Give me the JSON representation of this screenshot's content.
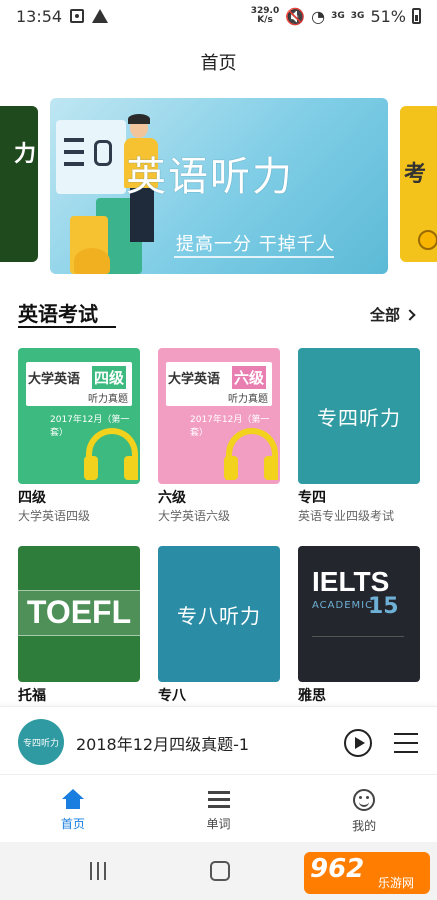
{
  "status_bar": {
    "time": "13:54",
    "speed_value": "329.0",
    "speed_unit": "K/s",
    "network_1": "3G",
    "network_2": "3G",
    "battery": "51%"
  },
  "header": {
    "title": "首页"
  },
  "banner": {
    "title": "英语听力",
    "subtitle": "提高一分 干掉千人",
    "prev_fragment": "力",
    "next_fragment": "考"
  },
  "section": {
    "title": "英语考试",
    "more_label": "全部"
  },
  "cards": [
    {
      "name": "四级",
      "desc": "大学英语四级",
      "thumb_main": "大学英语",
      "thumb_level": "四级",
      "thumb_sub": "听力真题",
      "thumb_date": "2017年12月（第一套）"
    },
    {
      "name": "六级",
      "desc": "大学英语六级",
      "thumb_main": "大学英语",
      "thumb_level": "六级",
      "thumb_sub": "听力真题",
      "thumb_date": "2017年12月（第一套）"
    },
    {
      "name": "专四",
      "desc": "英语专业四级考试",
      "thumb_text": "专四听力"
    },
    {
      "name": "托福",
      "desc": "",
      "thumb_text": "TOEFL"
    },
    {
      "name": "专八",
      "desc": "",
      "thumb_text": "专八听力"
    },
    {
      "name": "雅思",
      "desc": "",
      "thumb_text": "IELTS",
      "thumb_acad": "ACADEMIC",
      "thumb_num": "15"
    }
  ],
  "player": {
    "disc_label": "专四听力",
    "track_title": "2018年12月四级真题-1"
  },
  "bottom_nav": [
    {
      "label": "首页",
      "icon": "home-icon",
      "active": true
    },
    {
      "label": "单词",
      "icon": "list-icon",
      "active": false
    },
    {
      "label": "我的",
      "icon": "smile-icon",
      "active": false
    }
  ],
  "watermark": {
    "big": "962",
    "small": "乐游网"
  },
  "colors": {
    "accent": "#1a7ee0",
    "cet4": "#3dba7f",
    "cet6": "#f29ec2",
    "tem": "#2f9aa1"
  }
}
